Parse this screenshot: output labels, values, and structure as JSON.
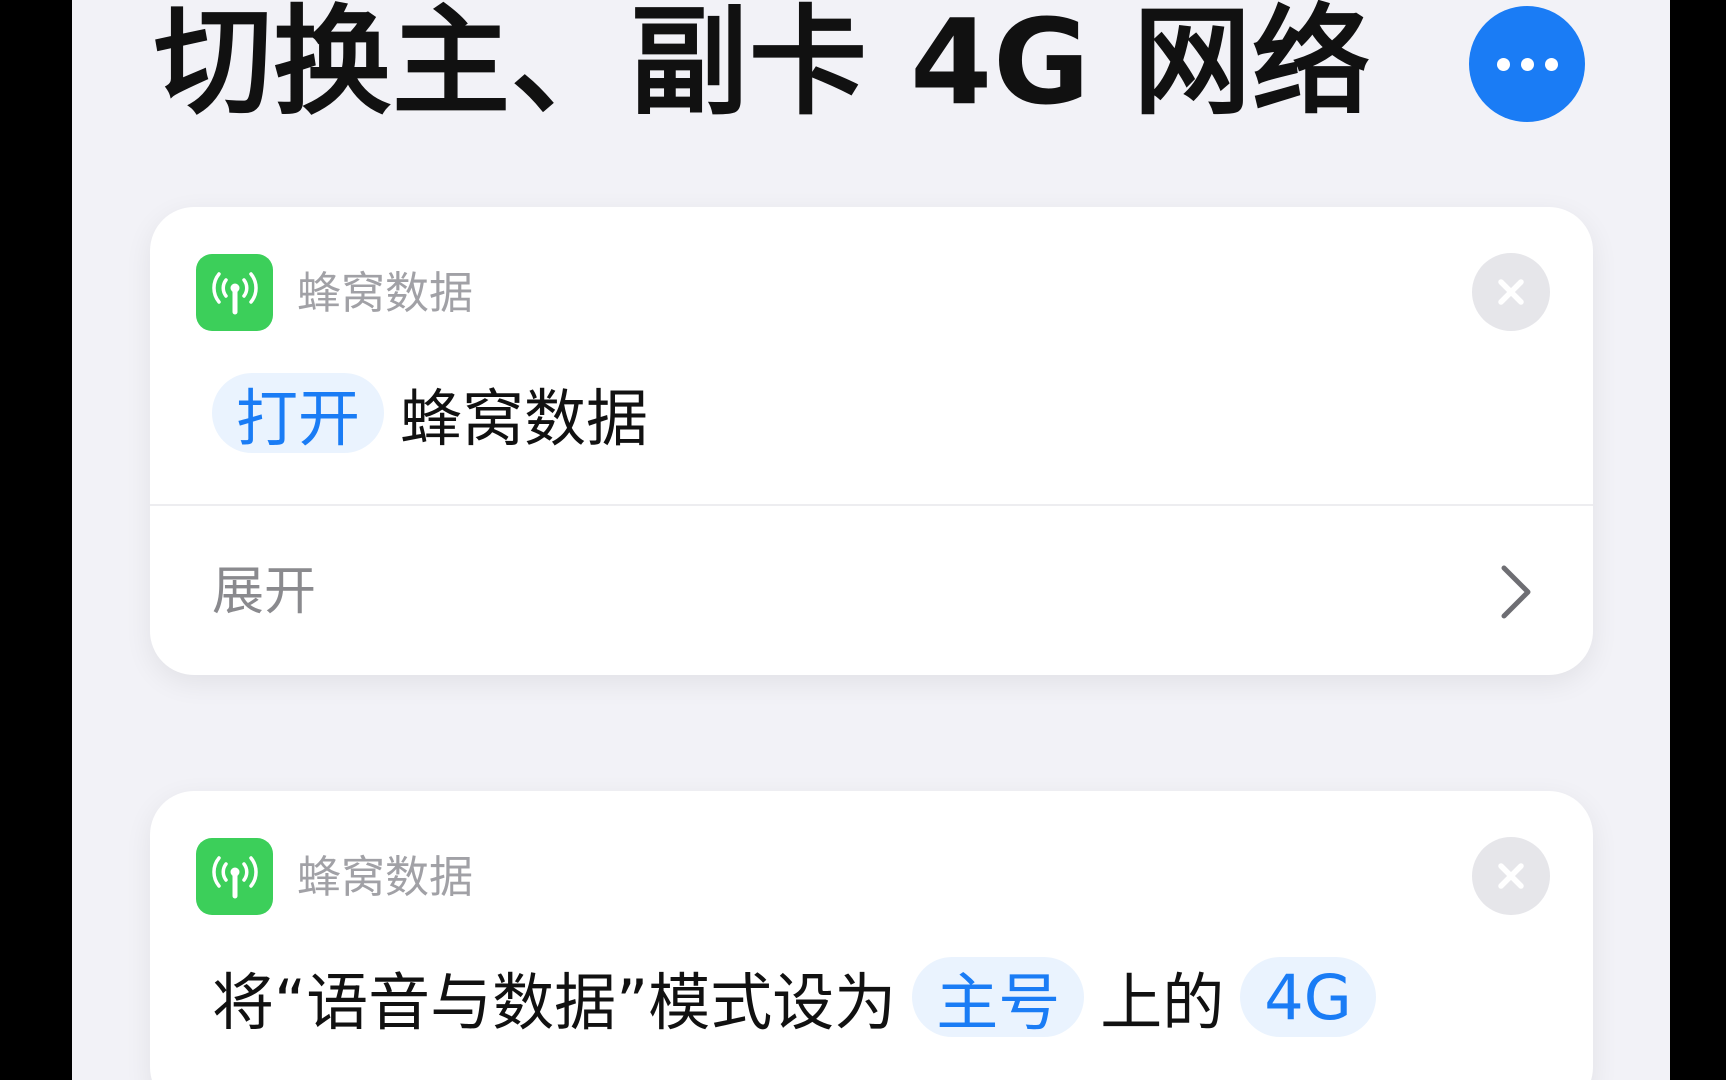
{
  "header": {
    "title": "切换主、副卡 4G 网络",
    "more_icon": "ellipsis-icon",
    "accent_color": "#1a7cf5"
  },
  "actions": [
    {
      "app_icon": "cellular-antenna-icon",
      "app_icon_color": "#3ccf5a",
      "app_name": "蜂窝数据",
      "remove_icon": "close-icon",
      "token": "打开",
      "text": "蜂窝数据",
      "expand_label": "展开",
      "expand_icon": "chevron-right-icon"
    },
    {
      "app_icon": "cellular-antenna-icon",
      "app_icon_color": "#3ccf5a",
      "app_name": "蜂窝数据",
      "remove_icon": "close-icon",
      "text_before": "将“语音与数据”模式设为",
      "token_line": "主号",
      "text_middle": "上的",
      "token_mode": "4G"
    }
  ]
}
